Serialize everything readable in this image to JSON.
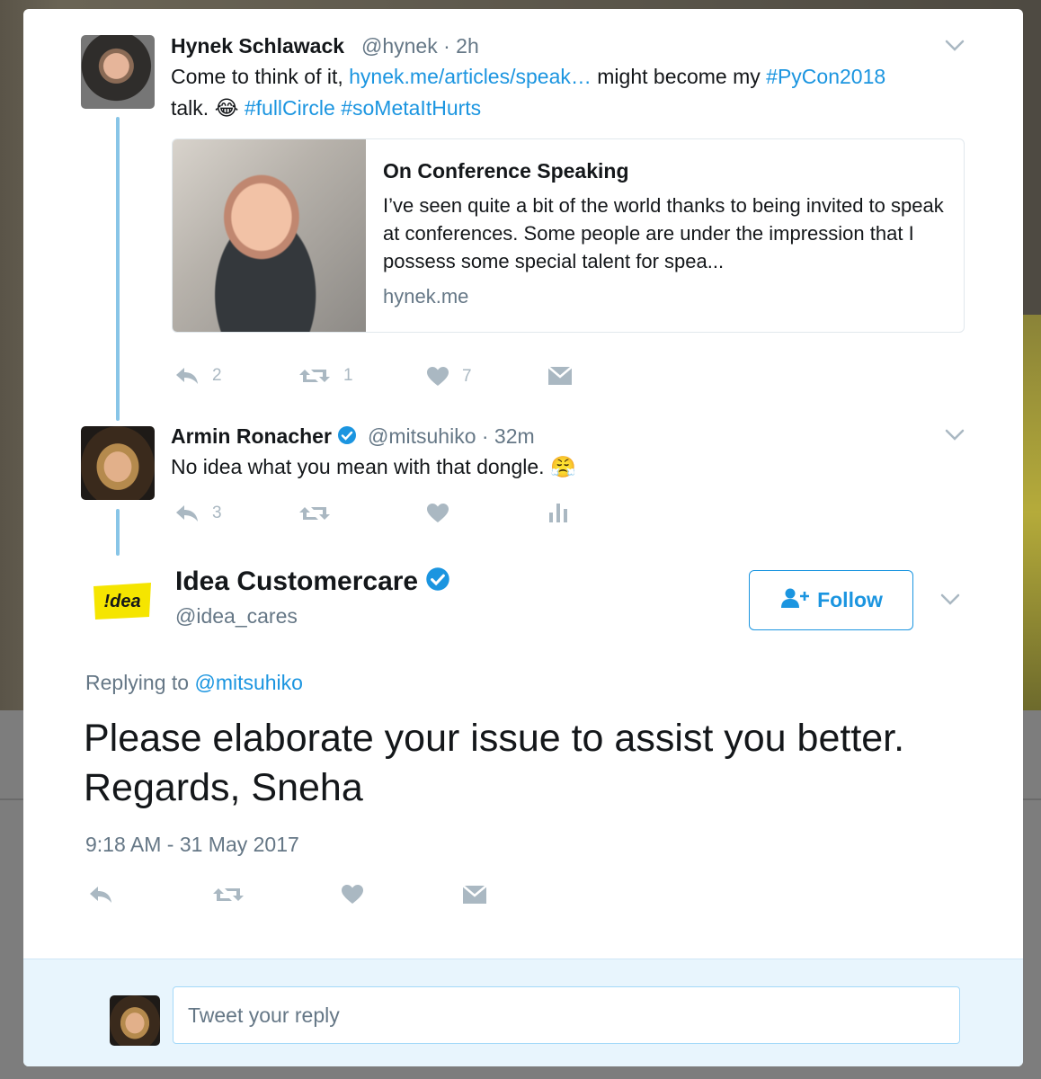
{
  "tweet1": {
    "name": "Hynek Schlawack",
    "handle_time": "@hynek · 2h",
    "text_line1_a": "Come to think of it, ",
    "text_line1_link": "hynek.me/articles/speak…",
    "text_line1_b": " might become my ",
    "text_line1_tag": "#PyCon2018",
    "text_line2_a": "talk. ",
    "emoji": "😂",
    "tag2": "#fullCircle",
    "tag3": "#soMetaItHurts",
    "card": {
      "title": "On Conference Speaking",
      "description": "I’ve seen quite a bit of the world thanks to being invited to speak at conferences. Some people are under the impression that I possess some special talent for spea...",
      "domain": "hynek.me"
    },
    "actions": {
      "reply_count": "2",
      "retweet_count": "1",
      "like_count": "7"
    }
  },
  "tweet2": {
    "name": "Armin Ronacher",
    "handle_time": "@mitsuhiko · 32m",
    "text": "No idea what you mean with that dongle. ",
    "emoji": "😤",
    "actions": {
      "reply_count": "3"
    }
  },
  "main_tweet": {
    "logo_text": "!dea",
    "name": "Idea Customercare",
    "handle": "@idea_cares",
    "follow_label": "Follow",
    "replying_prefix": "Replying to ",
    "replying_handle": "@mitsuhiko",
    "text": "Please elaborate your issue to assist you better. Regards, Sneha",
    "timestamp": "9:18 AM - 31 May 2017"
  },
  "reply_box": {
    "placeholder": "Tweet your reply"
  },
  "colors": {
    "link": "#1b95e0",
    "thread_line": "#88c5e7",
    "muted": "#657786",
    "icon": "#aab8c2",
    "reply_bg": "#e8f5fd",
    "idea_yellow": "#f5e500"
  }
}
